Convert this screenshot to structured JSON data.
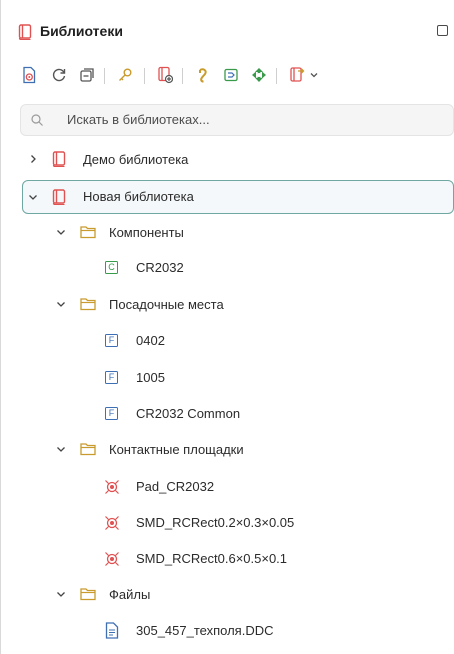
{
  "panel": {
    "title": "Библиотеки",
    "icons": {
      "title": "library-book-icon",
      "maximize": "maximize-square-icon"
    }
  },
  "toolbar": {
    "buttons": [
      "new-document-icon",
      "refresh-icon",
      "collapse-all-icon",
      "key-icon",
      "add-library-icon",
      "link-icon",
      "pad-editor-icon",
      "move-icon",
      "export-icon",
      "dropdown-chevron-icon"
    ]
  },
  "search": {
    "placeholder": "Искать в библиотеках..."
  },
  "colors": {
    "accent_border": "#6fa7a3",
    "book_red": "#e05252",
    "folder_gold": "#c89b2c",
    "component_green": "#3a9a4b",
    "footprint_blue": "#3f6fb3",
    "pad_red": "#e05252"
  },
  "tree": {
    "demo_library": {
      "label": "Демо библиотека",
      "expanded": false
    },
    "new_library": {
      "label": "Новая библиотека",
      "expanded": true,
      "selected": true,
      "folders": {
        "components": {
          "label": "Компоненты",
          "items": [
            "CR2032"
          ]
        },
        "footprints": {
          "label": "Посадочные места",
          "items": [
            "0402",
            "1005",
            "CR2032 Common"
          ]
        },
        "pads": {
          "label": "Контактные площадки",
          "items": [
            "Pad_CR2032",
            "SMD_RCRect0.2×0.3×0.05",
            "SMD_RCRect0.6×0.5×0.1"
          ]
        },
        "files": {
          "label": "Файлы",
          "items": [
            "305_457_техполя.DDC"
          ]
        }
      }
    },
    "item_type_letters": {
      "component": "C",
      "footprint": "F"
    }
  }
}
